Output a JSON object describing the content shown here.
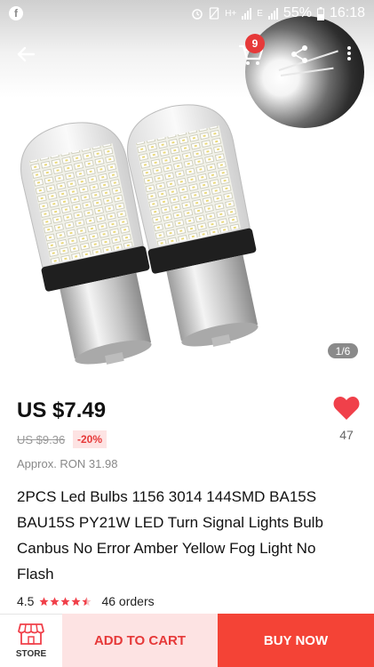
{
  "status_bar": {
    "left_icon": "facebook-icon",
    "net1": "H+",
    "net2": "E",
    "battery": "55%",
    "time": "16:18"
  },
  "header": {
    "back_icon": "arrow-left-icon",
    "cart_icon": "cart-icon",
    "cart_count": "9",
    "share_icon": "share-icon",
    "more_icon": "more-vertical-icon"
  },
  "gallery": {
    "counter": "1/6"
  },
  "product": {
    "price": "US $7.49",
    "original_price": "US $9.36",
    "discount": "-20%",
    "approx": "Approx. RON 31.98",
    "wishlist_count": "47",
    "title": "2PCS Led Bulbs 1156 3014 144SMD BA15S BAU15S PY21W LED Turn Signal Lights Bulb Canbus No Error Amber Yellow Fog Light No Flash",
    "rating": "4.5",
    "orders": "46 orders"
  },
  "bottom_bar": {
    "store_label": "STORE",
    "add_to_cart": "ADD TO CART",
    "buy_now": "BUY NOW"
  },
  "colors": {
    "accent": "#f44336",
    "accent_light": "#fde3e3",
    "accent_text": "#e63939"
  }
}
